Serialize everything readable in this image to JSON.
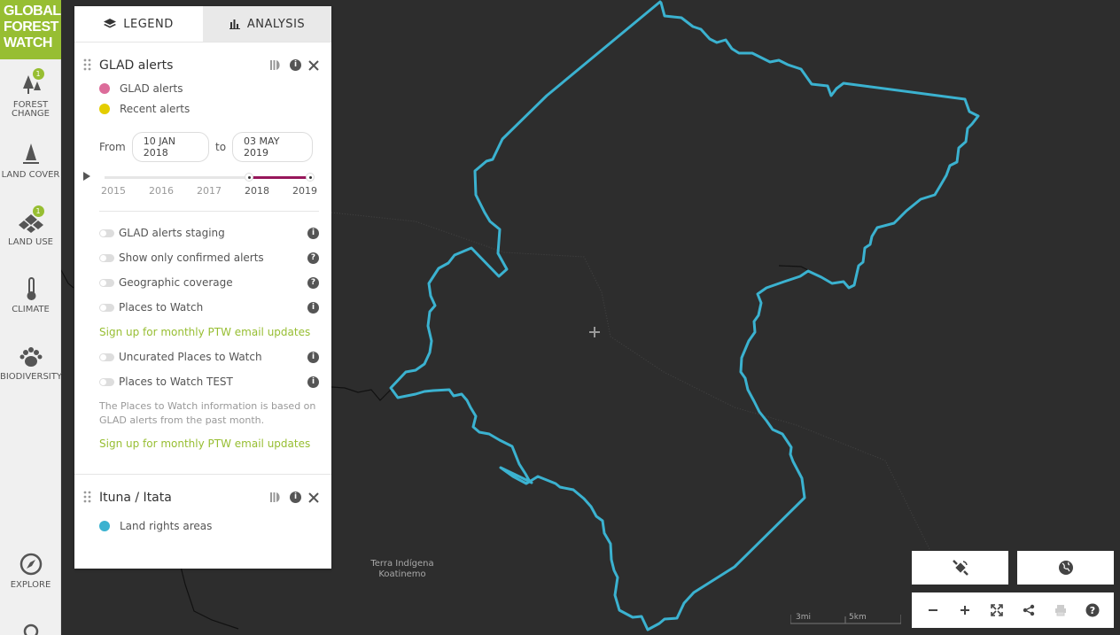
{
  "brand": {
    "line1": "GLOBAL",
    "line2": "FOREST",
    "line3": "WATCH",
    "color": "#97be32"
  },
  "nav": {
    "items": [
      {
        "label1": "FOREST",
        "label2": "CHANGE",
        "icon": "forest-change-icon",
        "badge": "1"
      },
      {
        "label1": "LAND COVER",
        "icon": "land-cover-icon"
      },
      {
        "label1": "LAND USE",
        "icon": "land-use-icon",
        "badge": "1"
      },
      {
        "label1": "CLIMATE",
        "icon": "thermometer-icon"
      },
      {
        "label1": "BIODIVERSITY",
        "icon": "paw-icon"
      }
    ],
    "explore": "EXPLORE"
  },
  "tabs": {
    "legend": "LEGEND",
    "analysis": "ANALYSIS"
  },
  "glad": {
    "title": "GLAD alerts",
    "legend": [
      {
        "label": "GLAD alerts",
        "color": "#dc6c9a"
      },
      {
        "label": "Recent alerts",
        "color": "#e4cd00"
      }
    ],
    "from_label": "From",
    "to_label": "to",
    "start_date": "10 JAN 2018",
    "end_date": "03 MAY 2019",
    "years": [
      "2015",
      "2016",
      "2017",
      "2018",
      "2019"
    ],
    "selection_color": "#97175b",
    "toggles": [
      {
        "label": "GLAD alerts staging",
        "info": "i"
      },
      {
        "label": "Show only confirmed alerts",
        "info": "?"
      },
      {
        "label": "Geographic coverage",
        "info": "?"
      },
      {
        "label": "Places to Watch",
        "info": "i"
      }
    ],
    "signup_link_1": "Sign up for monthly PTW email updates",
    "toggles2": [
      {
        "label": "Uncurated Places to Watch",
        "info": "i"
      },
      {
        "label": "Places to Watch TEST",
        "info": "i"
      }
    ],
    "note": "The Places to Watch information is based on GLAD alerts from the past month.",
    "signup_link_2": "Sign up for monthly PTW email updates"
  },
  "ituna": {
    "title": "Ituna / Itata",
    "legend": [
      {
        "label": "Land rights areas",
        "color": "#3bb2d0"
      }
    ]
  },
  "map": {
    "label": "Terra Indígena Koatinemo",
    "scale_a": "3mi",
    "scale_b": "5km",
    "boundary_color": "#3bb2d0"
  }
}
